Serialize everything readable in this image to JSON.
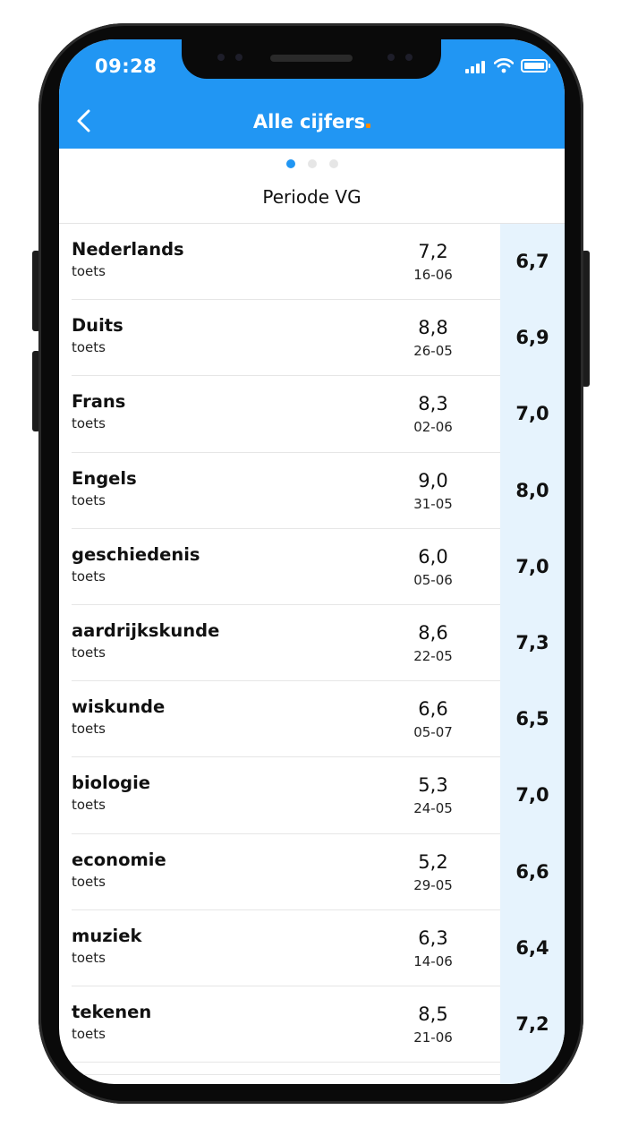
{
  "status_bar": {
    "time": "09:28"
  },
  "header": {
    "title": "Alle cijfers",
    "accent_color": "#ff8a00",
    "background_color": "#2196f3"
  },
  "pager": {
    "count": 3,
    "active_index": 0
  },
  "period": {
    "label": "Periode VG"
  },
  "rows": [
    {
      "subject": "Nederlands",
      "type": "toets",
      "grade": "7,2",
      "date": "16-06",
      "average": "6,7"
    },
    {
      "subject": "Duits",
      "type": "toets",
      "grade": "8,8",
      "date": "26-05",
      "average": "6,9"
    },
    {
      "subject": "Frans",
      "type": "toets",
      "grade": "8,3",
      "date": "02-06",
      "average": "7,0"
    },
    {
      "subject": "Engels",
      "type": "toets",
      "grade": "9,0",
      "date": "31-05",
      "average": "8,0"
    },
    {
      "subject": "geschiedenis",
      "type": "toets",
      "grade": "6,0",
      "date": "05-06",
      "average": "7,0"
    },
    {
      "subject": "aardrijkskunde",
      "type": "toets",
      "grade": "8,6",
      "date": "22-05",
      "average": "7,3"
    },
    {
      "subject": "wiskunde",
      "type": "toets",
      "grade": "6,6",
      "date": "05-07",
      "average": "6,5"
    },
    {
      "subject": "biologie",
      "type": "toets",
      "grade": "5,3",
      "date": "24-05",
      "average": "7,0"
    },
    {
      "subject": "economie",
      "type": "toets",
      "grade": "5,2",
      "date": "29-05",
      "average": "6,6"
    },
    {
      "subject": "muziek",
      "type": "toets",
      "grade": "6,3",
      "date": "14-06",
      "average": "6,4"
    },
    {
      "subject": "tekenen",
      "type": "toets",
      "grade": "8,5",
      "date": "21-06",
      "average": "7,2"
    }
  ]
}
